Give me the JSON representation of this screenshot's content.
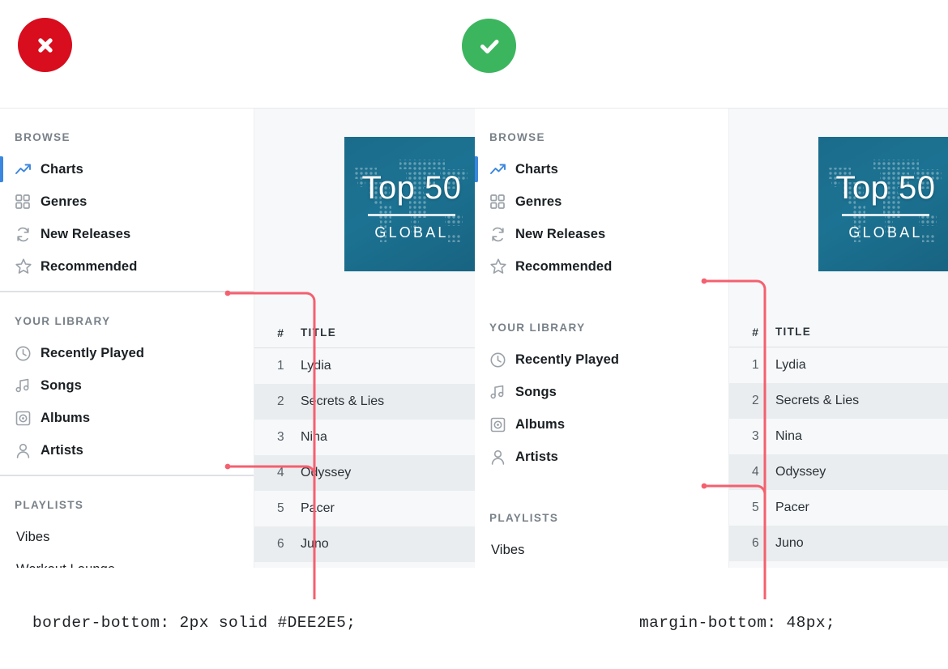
{
  "badges": {
    "bad": {
      "icon": "close-icon",
      "color": "#D80D1E"
    },
    "good": {
      "icon": "check-icon",
      "color": "#3CB55F"
    }
  },
  "accent": {
    "active_indicator": "#3B86DE",
    "leader_line": "#F4606F",
    "divider": "#DEE2E5"
  },
  "sidebar": {
    "sections": [
      {
        "title": "BROWSE",
        "items": [
          {
            "label": "Charts",
            "icon": "trend-up-icon",
            "active": true
          },
          {
            "label": "Genres",
            "icon": "grid-icon",
            "active": false
          },
          {
            "label": "New Releases",
            "icon": "refresh-icon",
            "active": false
          },
          {
            "label": "Recommended",
            "icon": "star-icon",
            "active": false
          }
        ]
      },
      {
        "title": "YOUR LIBRARY",
        "items": [
          {
            "label": "Recently Played",
            "icon": "clock-icon",
            "active": false
          },
          {
            "label": "Songs",
            "icon": "music-icon",
            "active": false
          },
          {
            "label": "Albums",
            "icon": "disc-icon",
            "active": false
          },
          {
            "label": "Artists",
            "icon": "person-icon",
            "active": false
          }
        ]
      },
      {
        "title": "PLAYLISTS",
        "items": [
          {
            "label": "Vibes",
            "icon": "",
            "active": false
          },
          {
            "label": "Workout Lounge",
            "icon": "",
            "active": false
          }
        ]
      }
    ]
  },
  "album": {
    "title": "Top 50",
    "subtitle": "GLOBAL",
    "background_color": "#1C7292"
  },
  "tracklist": {
    "columns": {
      "number": "#",
      "title": "TITLE"
    },
    "rows": [
      {
        "number": "1",
        "title": "Lydia"
      },
      {
        "number": "2",
        "title": "Secrets & Lies"
      },
      {
        "number": "3",
        "title": "Nina"
      },
      {
        "number": "4",
        "title": "Odyssey"
      },
      {
        "number": "5",
        "title": "Pacer"
      },
      {
        "number": "6",
        "title": "Juno"
      }
    ]
  },
  "annotations": {
    "left": "border-bottom: 2px solid #DEE2E5;",
    "right": "margin-bottom: 48px;"
  }
}
